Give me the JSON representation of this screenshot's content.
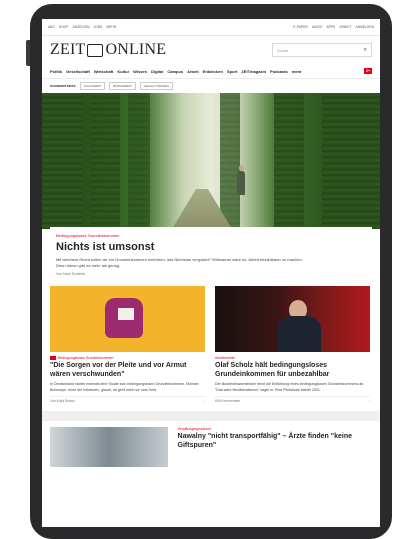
{
  "topbar": {
    "left_links": [
      "Abo",
      "Shop",
      "Anzeigen",
      "Jobs",
      "Mehr"
    ],
    "right_links": [
      "E-Paper",
      "Audio",
      "Apps",
      "Arbeit",
      "Anmelden"
    ]
  },
  "masthead": {
    "logo_left": "ZEIT",
    "logo_right": "ONLINE",
    "search_placeholder": "Suche"
  },
  "nav": {
    "items": [
      "Politik",
      "Gesellschaft",
      "Wirtschaft",
      "Kultur",
      "Wissen",
      "Digital",
      "Campus",
      "Arbeit",
      "Entdecken",
      "Sport",
      "ZEITmagazin",
      "Podcasts",
      "mehr"
    ],
    "badge": "Z+"
  },
  "tags": [
    "Schwerpunkte",
    "Volkswirt",
    "Bürgerrat",
    "Gehalt prüfen"
  ],
  "hero_article": {
    "kicker": "Bedingungsloses Grundeinkommen",
    "headline": "Nichts ist umsonst",
    "teaser": "Mit welchem Recht sollen wir ein Grundeinkommen einführen, das Nichtstun vergoldet? Wirksamer wäre es, Arbeit bezahlbarer zu machen. Denn davon gibt es mehr als genug.",
    "byline": "Von Mark Schieritz"
  },
  "cards": [
    {
      "kicker": "Bedingungsloses Grundeinkommen",
      "headline": "\"Die Sorgen vor der Pleite und vor Armut wären verschwunden\"",
      "text": "In Deutschland startet erstmals eine Studie zum bedingungslosen Grundeinkommen. Michael Bohmeyer, einer der Initiatoren, glaubt, da geht nicht nur ums Geld.",
      "byline": "Von Kolja Rudzio",
      "comments": ""
    },
    {
      "kicker": "Arbeitsmarkt",
      "headline": "Olaf Scholz hält bedingungsloses Grundeinkommen für unbezahlbar",
      "text": "Der Bundesfinanzminister lehnt die Einführung eines bedingungslosen Grundeinkommens ab. \"Das wäre Neoliberalismus\" sagte er. Eine Pilotstudie startet 2021.",
      "byline": "",
      "comments": "608 Kommentare"
    }
  ],
  "bottom_article": {
    "kicker": "Vergiftungssymptome",
    "headline": "Nawalny \"nicht transportfähig\" – Ärzte finden \"keine Giftspuren\""
  }
}
